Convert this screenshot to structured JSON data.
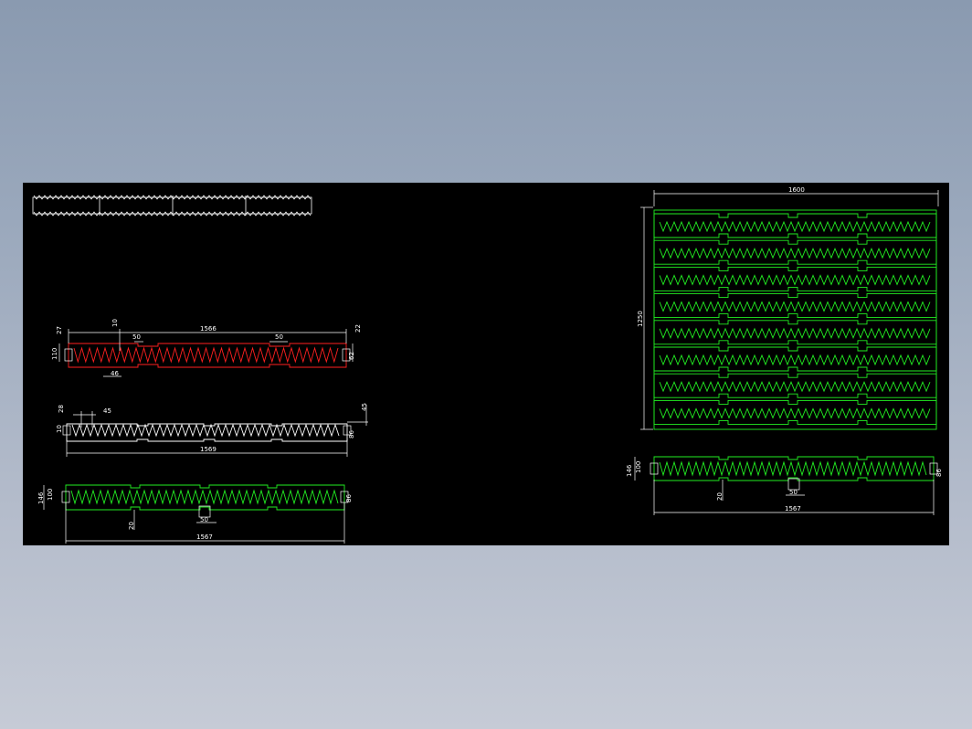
{
  "colors": {
    "background": "#000000",
    "stroke_white": "#ffffff",
    "stroke_red": "#ff2020",
    "stroke_green": "#22ee22",
    "page_gradient_top": "#8a9ab0",
    "page_gradient_bottom": "#c6cbd6"
  },
  "drawing": {
    "view1": {
      "dims": {
        "d27": "27",
        "d10": "10",
        "d1566": "1566",
        "d22": "22",
        "d50a": "50",
        "d50b": "50",
        "d110": "110",
        "d62": "62",
        "d46": "46"
      }
    },
    "view2": {
      "dims": {
        "d28": "28",
        "d45a": "45",
        "d45b": "45",
        "d10": "10",
        "d86": "86",
        "d1569": "1569"
      }
    },
    "view3": {
      "dims": {
        "d146": "146",
        "d100": "100",
        "d20": "20",
        "d50": "50",
        "d86": "86",
        "d1567": "1567"
      }
    },
    "assembly": {
      "dims": {
        "d1600": "1600",
        "d1250": "1250"
      },
      "rows": 8
    },
    "view4": {
      "dims": {
        "d146": "146",
        "d100": "100",
        "d20": "20",
        "d50": "50",
        "d86": "86",
        "d1567": "1567"
      }
    }
  }
}
